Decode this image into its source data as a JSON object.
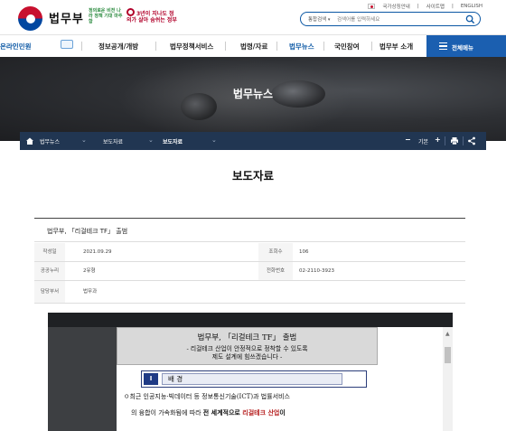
{
  "header": {
    "logo_text": "법무부",
    "slogan_green": "정의로운 비전 나라 정책 기대 마주함",
    "slogan_red": "3년이 지나도 정의가 살아 숨쉬는 정부",
    "util_nav": [
      "국가상징안내",
      "사이트맵",
      "ENGLISH"
    ],
    "search": {
      "scope": "통합검색",
      "placeholder": "검색어를 입력하세요"
    }
  },
  "gnb": {
    "online": "온라인민원",
    "items": [
      "정보공개/개방",
      "법무정책서비스",
      "법령/자료",
      "법무뉴스",
      "국민참여",
      "법무부 소개"
    ],
    "active_index": 3,
    "menu_button": "전체메뉴"
  },
  "hero": {
    "title": "법무뉴스"
  },
  "breadcrumb": {
    "items": [
      "법무뉴스",
      "보도자료",
      "보도자료"
    ],
    "controls": {
      "minus": "−",
      "basic": "기본",
      "plus": "+"
    }
  },
  "page_title": "보도자료",
  "article": {
    "title": "법무부, 「리걸테크 TF」 출범",
    "rows": [
      {
        "label1": "작성일",
        "value1": "2021.09.29",
        "label2": "조회수",
        "value2": "106"
      },
      {
        "label1": "공공누리",
        "value1": "2유형",
        "label2": "전화번호",
        "value2": "02-2110-3923"
      },
      {
        "label1": "담당부서",
        "value1": "법무과",
        "label2": "",
        "value2": ""
      }
    ]
  },
  "document": {
    "title": "법무부, 「리걸테크 TF」 출범",
    "subtitle_line1": "- 리걸테크 산업이 안정적으로 정착할 수 있도록",
    "subtitle_line2": "제도 설계에 힘쓰겠습니다 -",
    "section_num": "Ⅰ",
    "section_label": "배 경",
    "para1": "ㅇ최근 인공지능·빅데이터 등 정보통신기술(ICT)과 법률서비스",
    "para2_pre": "의 융합이 가속화됨에 따라 ",
    "para2_bold": "전 세계적으로 ",
    "para2_red": "리걸테크 산업",
    "para2_post": "이"
  },
  "colors": {
    "brand_blue": "#0b57a4",
    "menu_blue": "#1b5fb0",
    "crumb_bg": "#213652",
    "doc_section": "#1f3a85"
  }
}
